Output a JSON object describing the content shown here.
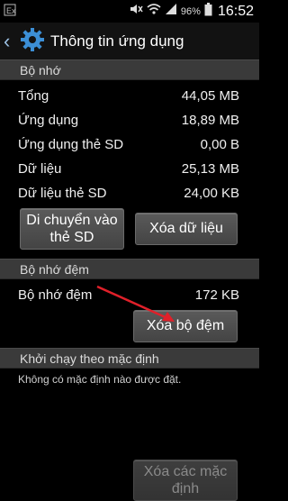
{
  "status_bar": {
    "battery_percent": "96%",
    "time": "16:52"
  },
  "header": {
    "title": "Thông tin ứng dụng"
  },
  "memory": {
    "section_title": "Bộ nhớ",
    "rows": [
      {
        "label": "Tổng",
        "value": "44,05 MB"
      },
      {
        "label": "Ứng dụng",
        "value": "18,89 MB"
      },
      {
        "label": "Ứng dụng thẻ SD",
        "value": "0,00 B"
      },
      {
        "label": "Dữ liệu",
        "value": "25,13 MB"
      },
      {
        "label": "Dữ liệu thẻ SD",
        "value": "24,00 KB"
      }
    ],
    "move_button": "Di chuyển vào thẻ SD",
    "clear_data_button": "Xóa dữ liệu"
  },
  "cache": {
    "section_title": "Bộ nhớ đệm",
    "label": "Bộ nhớ đệm",
    "value": "172 KB",
    "clear_cache_button": "Xóa bộ đệm"
  },
  "launch_default": {
    "section_title": "Khởi chạy theo mặc định",
    "note": "Không có mặc định nào được đặt.",
    "clear_defaults_button": "Xóa các mặc định"
  },
  "colors": {
    "background": "#000000",
    "section_header": "#3a3a3a",
    "annotation_arrow": "#e0202a",
    "icon_blue": "#3c8fd6"
  }
}
